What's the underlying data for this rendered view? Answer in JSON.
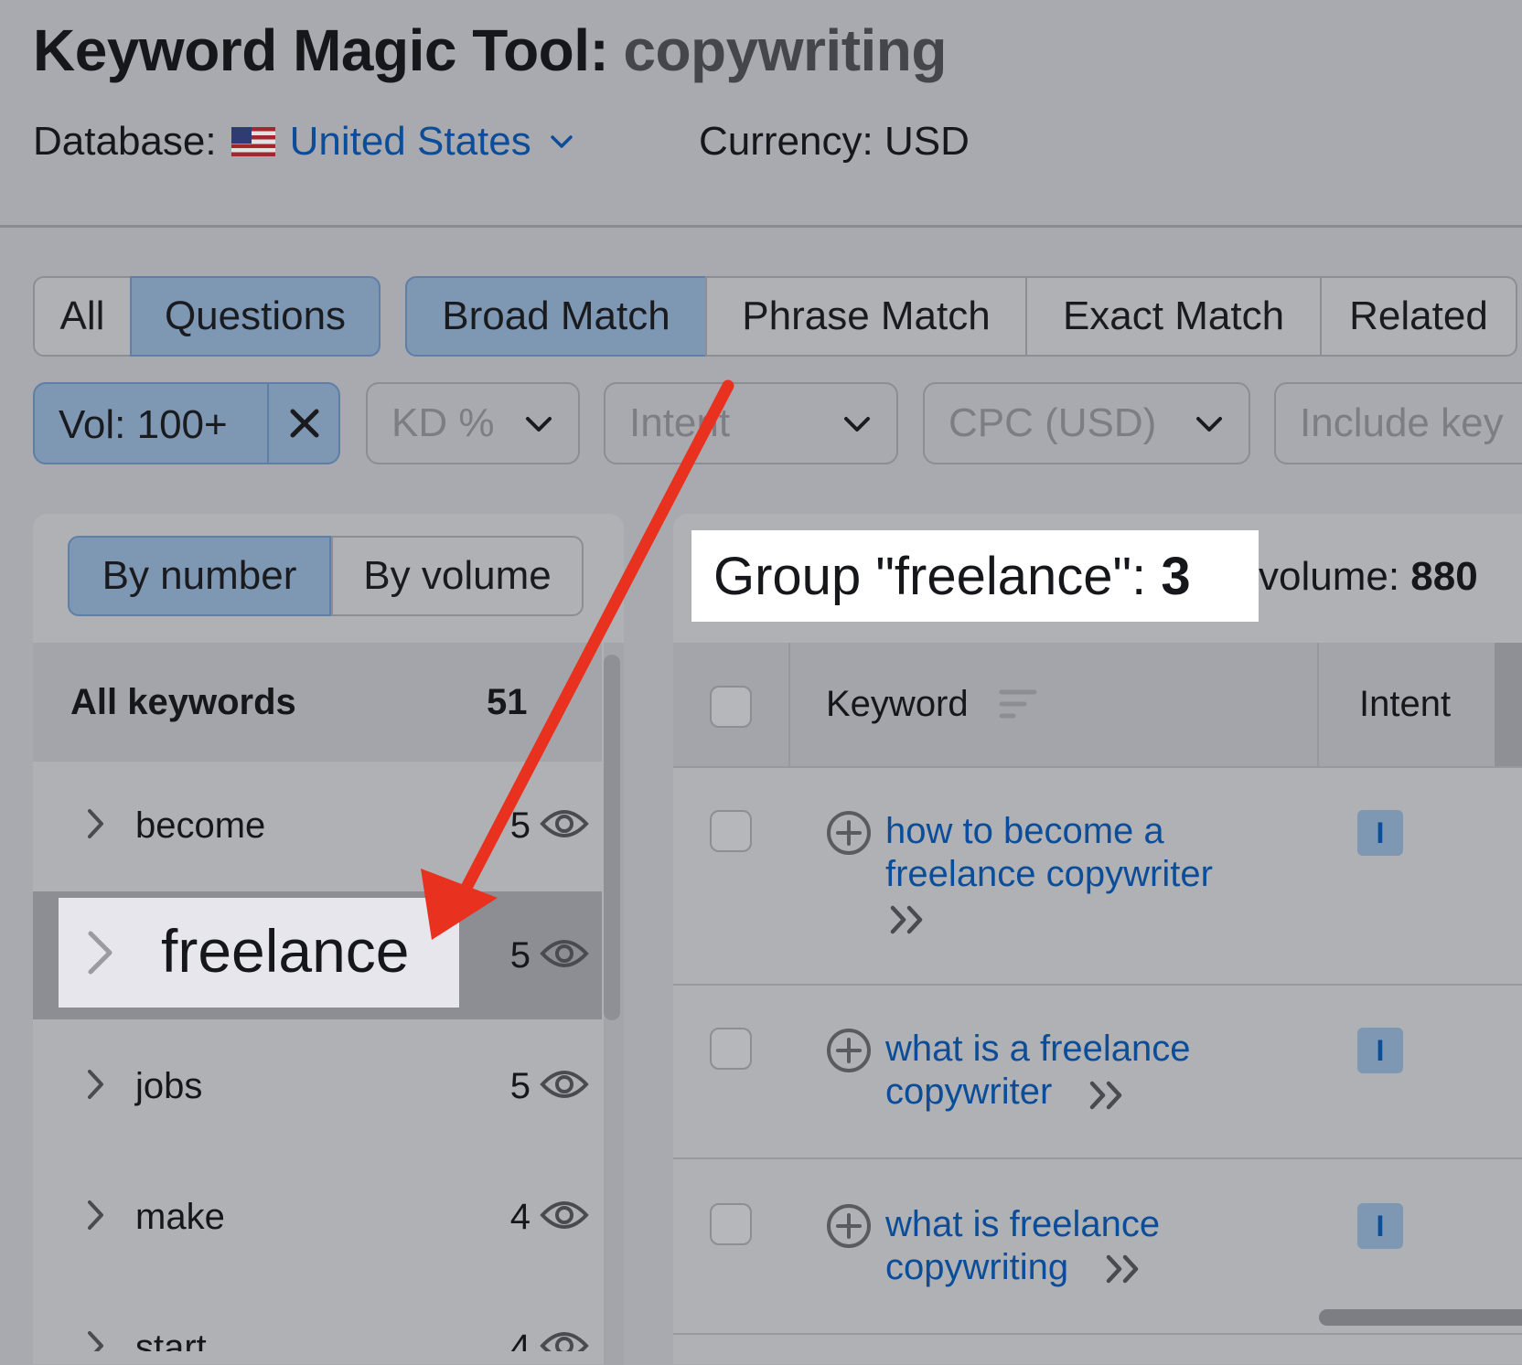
{
  "header": {
    "title": "Keyword Magic Tool:",
    "query": "copywriting",
    "database_label": "Database:",
    "database_country": "United States",
    "currency": "Currency: USD"
  },
  "match_tabs": {
    "all": "All",
    "questions": "Questions",
    "broad": "Broad Match",
    "phrase": "Phrase Match",
    "exact": "Exact Match",
    "related": "Related"
  },
  "filters": {
    "volume": "Vol: 100+",
    "kd": "KD %",
    "intent": "Intent",
    "cpc": "CPC (USD)",
    "include": "Include key"
  },
  "groups_panel": {
    "sort_by_number": "By number",
    "sort_by_volume": "By volume",
    "all_keywords_label": "All keywords",
    "all_keywords_count": "51",
    "groups": [
      {
        "label": "become",
        "count": "5"
      },
      {
        "label": "freelance",
        "count": "5"
      },
      {
        "label": "jobs",
        "count": "5"
      },
      {
        "label": "make",
        "count": "4"
      },
      {
        "label": "start",
        "count": "4"
      }
    ]
  },
  "results": {
    "group_prefix": "Group \"freelance\": ",
    "group_count": "3",
    "volume_prefix": "volume: ",
    "volume_value": "880",
    "columns": {
      "keyword": "Keyword",
      "intent": "Intent"
    },
    "rows": [
      {
        "line1": "how to become a",
        "line2": "freelance copywriter",
        "intent": "I"
      },
      {
        "line1": "what is a freelance",
        "line2": "copywriter",
        "intent": "I"
      },
      {
        "line1": "what is freelance",
        "line2": "copywriting",
        "intent": "I"
      }
    ]
  },
  "colors": {
    "accent_blue": "#0b4d99",
    "annotation_arrow": "#e8321f",
    "active_tab": "#7e97b3"
  }
}
